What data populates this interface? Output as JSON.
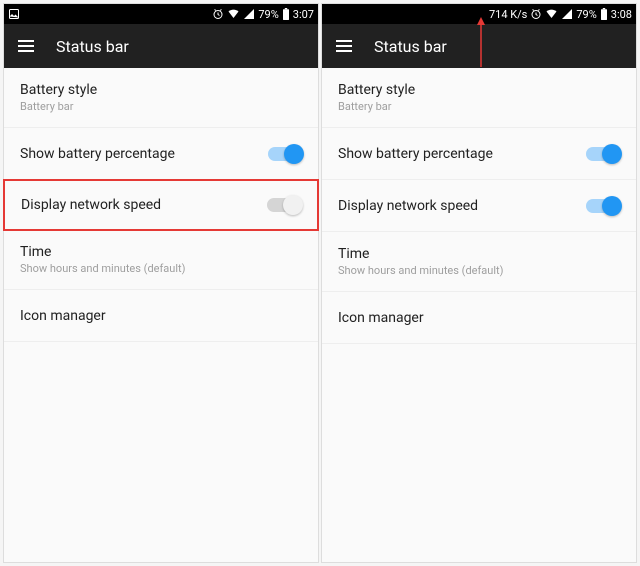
{
  "left": {
    "statusbar": {
      "network_speed": "",
      "battery_pct": "79%",
      "time": "3:07"
    },
    "toolbar": {
      "title": "Status bar"
    },
    "rows": {
      "battery_style": {
        "title": "Battery style",
        "subtitle": "Battery bar"
      },
      "show_battery": {
        "title": "Show battery percentage"
      },
      "display_speed": {
        "title": "Display network speed"
      },
      "time": {
        "title": "Time",
        "subtitle": "Show hours and minutes (default)"
      },
      "icon_manager": {
        "title": "Icon manager"
      }
    },
    "toggles": {
      "show_battery": true,
      "display_speed": false
    }
  },
  "right": {
    "statusbar": {
      "network_speed": "714 K/s",
      "battery_pct": "79%",
      "time": "3:08"
    },
    "toolbar": {
      "title": "Status bar"
    },
    "rows": {
      "battery_style": {
        "title": "Battery style",
        "subtitle": "Battery bar"
      },
      "show_battery": {
        "title": "Show battery percentage"
      },
      "display_speed": {
        "title": "Display network speed"
      },
      "time": {
        "title": "Time",
        "subtitle": "Show hours and minutes (default)"
      },
      "icon_manager": {
        "title": "Icon manager"
      }
    },
    "toggles": {
      "show_battery": true,
      "display_speed": true
    }
  }
}
